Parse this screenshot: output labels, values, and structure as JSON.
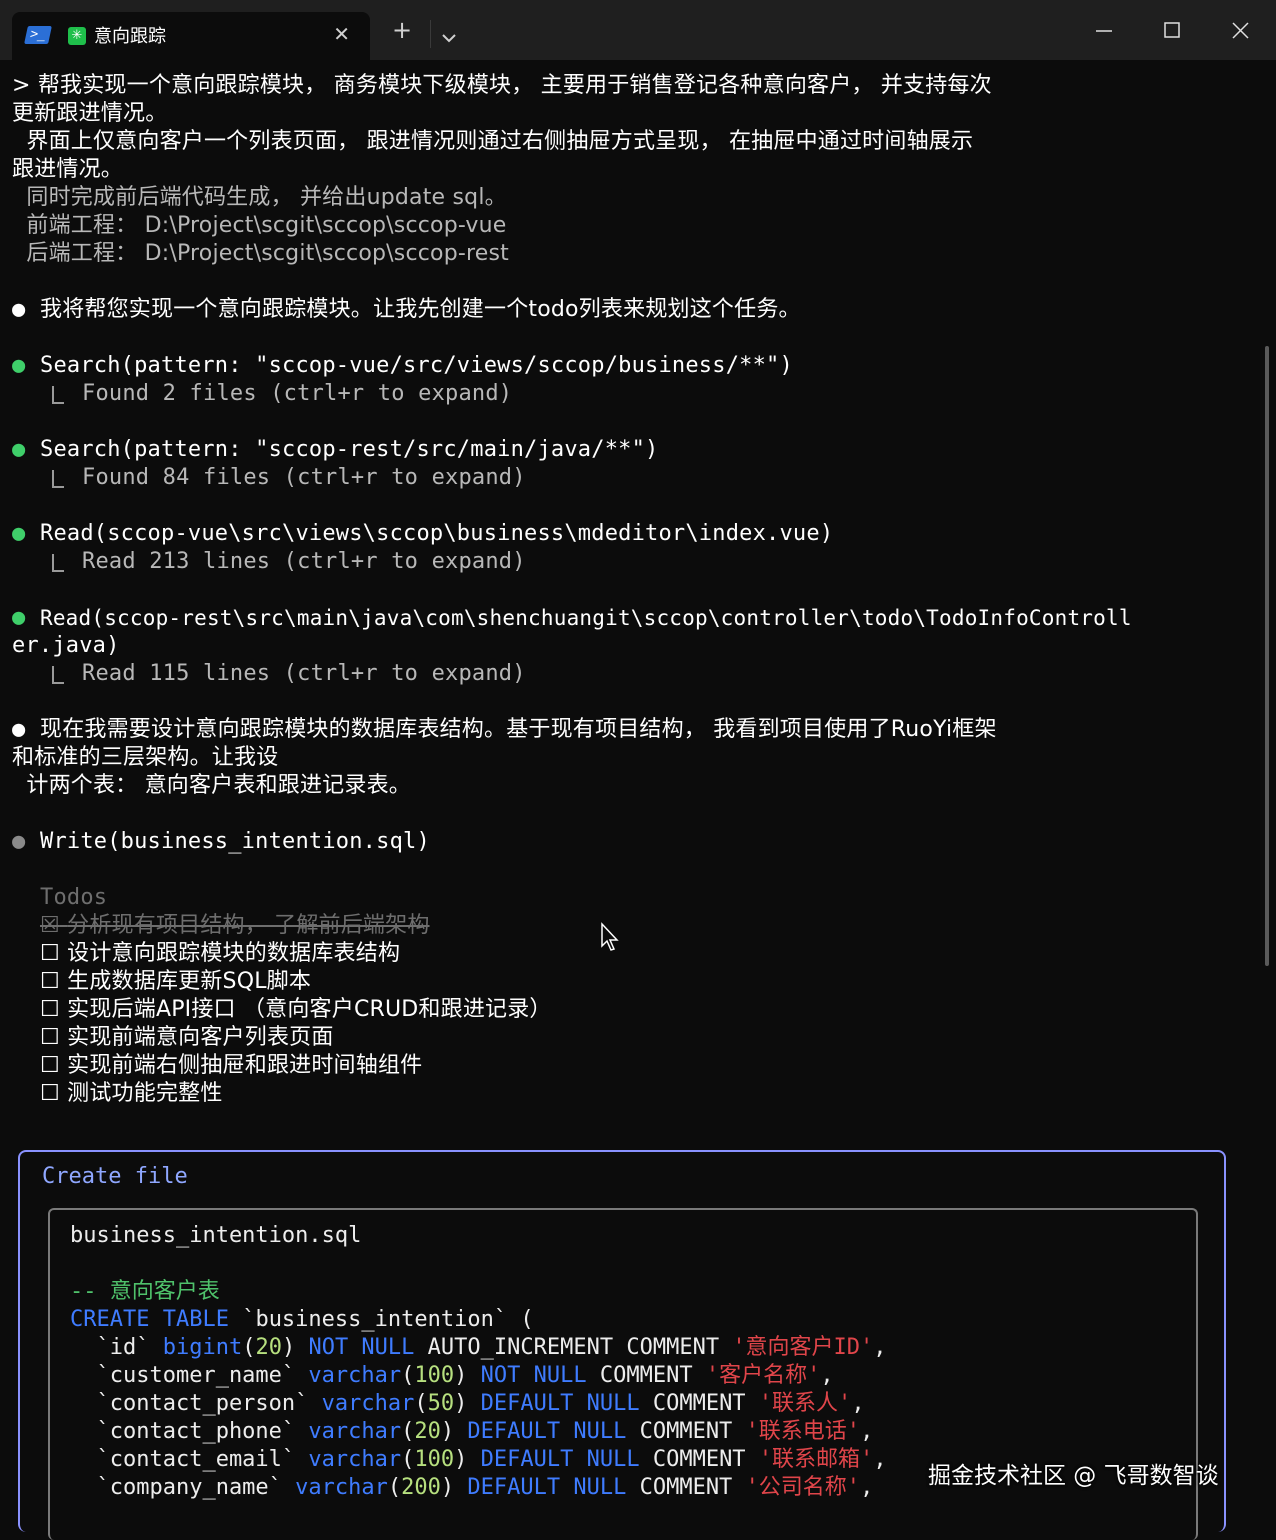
{
  "window": {
    "tab_title": "意向跟踪",
    "close_glyph": "✕",
    "newtab_glyph": "+",
    "ps_glyph": ">_",
    "app_glyph": "✳"
  },
  "prompt": {
    "line1": "> 帮我实现一个意向跟踪模块， 商务模块下级模块， 主要用于销售登记各种意向客户， 并支持每次",
    "line2": "更新跟进情况。",
    "line3": "  界面上仅意向客户一个列表页面， 跟进情况则通过右侧抽屉方式呈现， 在抽屉中通过时间轴展示",
    "line4": "跟进情况。",
    "line5": "  同时完成前后端代码生成， 并给出update sql。",
    "line6": "  前端工程： D:\\Project\\scgit\\sccop\\sccop-vue",
    "line7": "  后端工程： D:\\Project\\scgit\\sccop\\sccop-rest"
  },
  "messages": {
    "m1": "我将帮您实现一个意向跟踪模块。让我先创建一个todo列表来规划这个任务。",
    "tool1": "Search(pattern: \"sccop-vue/src/views/sccop/business/**\")",
    "tool1_result": "Found 2 files (ctrl+r to expand)",
    "tool2": "Search(pattern: \"sccop-rest/src/main/java/**\")",
    "tool2_result": "Found 84 files (ctrl+r to expand)",
    "tool3": "Read(sccop-vue\\src\\views\\sccop\\business\\mdeditor\\index.vue)",
    "tool3_result": "Read 213 lines (ctrl+r to expand)",
    "tool4_a": "Read(sccop-rest\\src\\main\\java\\com\\shenchuangit\\sccop\\controller\\todo\\TodoInfoControll",
    "tool4_b": "er.java)",
    "tool4_result": "Read 115 lines (ctrl+r to expand)",
    "m2_a": "现在我需要设计意向跟踪模块的数据库表结构。基于现有项目结构， 我看到项目使用了RuoYi框架",
    "m2_b": "和标准的三层架构。让我设",
    "m2_c": "  计两个表： 意向客户表和跟进记录表。",
    "tool5": "Write(business_intention.sql)",
    "bullet": "●"
  },
  "todos": {
    "title": "Todos",
    "items": [
      {
        "box": "☒",
        "text": "分析现有项目结构， 了解前后端架构",
        "done": true
      },
      {
        "box": "☐",
        "text": "设计意向跟踪模块的数据库表结构",
        "done": false
      },
      {
        "box": "☐",
        "text": "生成数据库更新SQL脚本",
        "done": false
      },
      {
        "box": "☐",
        "text": "实现后端API接口 （意向客户CRUD和跟进记录）",
        "done": false
      },
      {
        "box": "☐",
        "text": "实现前端意向客户列表页面",
        "done": false
      },
      {
        "box": "☐",
        "text": "实现前端右侧抽屉和跟进时间轴组件",
        "done": false
      },
      {
        "box": "☐",
        "text": "测试功能完整性",
        "done": false
      }
    ]
  },
  "create_file": {
    "title": "Create file",
    "filename": "business_intention.sql",
    "comment": "-- 意向客户表",
    "create_kw": "CREATE TABLE",
    "table_name": " `business_intention` (",
    "columns": [
      {
        "name": "  `id` ",
        "type": "bigint",
        "len": "20",
        "attrs": "NOT NULL",
        "extra": " AUTO_INCREMENT COMMENT ",
        "comment": "'意向客户ID'",
        "tail": ","
      },
      {
        "name": "  `customer_name` ",
        "type": "varchar",
        "len": "100",
        "attrs": "NOT NULL",
        "extra": " COMMENT ",
        "comment": "'客户名称'",
        "tail": ","
      },
      {
        "name": "  `contact_person` ",
        "type": "varchar",
        "len": "50",
        "attrs": "DEFAULT NULL",
        "extra": " COMMENT ",
        "comment": "'联系人'",
        "tail": ","
      },
      {
        "name": "  `contact_phone` ",
        "type": "varchar",
        "len": "20",
        "attrs": "DEFAULT NULL",
        "extra": " COMMENT ",
        "comment": "'联系电话'",
        "tail": ","
      },
      {
        "name": "  `contact_email` ",
        "type": "varchar",
        "len": "100",
        "attrs": "DEFAULT NULL",
        "extra": " COMMENT ",
        "comment": "'联系邮箱'",
        "tail": ","
      },
      {
        "name": "  `company_name` ",
        "type": "varchar",
        "len": "200",
        "attrs": "DEFAULT NULL",
        "extra": " COMMENT ",
        "comment": "'公司名称'",
        "tail": ","
      }
    ]
  },
  "watermark": "掘金技术社区 @ 飞哥数智谈"
}
